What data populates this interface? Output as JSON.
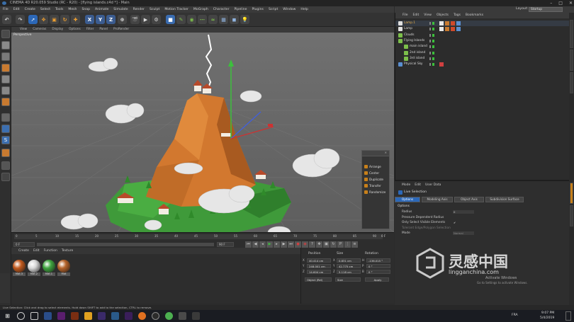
{
  "window": {
    "title": "CINEMA 4D R20.059 Studio (RC - R20) - [flying islands.c4d *] - Main"
  },
  "menubar": {
    "items": [
      "File",
      "Edit",
      "Create",
      "Select",
      "Tools",
      "Mesh",
      "Snap",
      "Animate",
      "Simulate",
      "Render",
      "Sculpt",
      "Motion Tracker",
      "MoGraph",
      "Character",
      "Pipeline",
      "Plugins",
      "Script",
      "Window",
      "Help"
    ]
  },
  "layout": {
    "label": "Layout:",
    "value": "Startup"
  },
  "toolbar": {
    "x": "X",
    "y": "Y",
    "z": "Z"
  },
  "viewport": {
    "menu": [
      "View",
      "Cameras",
      "Display",
      "Options",
      "Filter",
      "Panel",
      "ProRender"
    ],
    "label": "Perspective"
  },
  "popup": {
    "items": [
      "Arrange",
      "Center",
      "Duplicate",
      "Transfer",
      "Randomize"
    ]
  },
  "timeline": {
    "ticks": [
      "0",
      "5",
      "10",
      "15",
      "20",
      "25",
      "30",
      "35",
      "40",
      "45",
      "50",
      "55",
      "60",
      "65",
      "70",
      "75",
      "80",
      "85",
      "90"
    ],
    "frame_start": "0 F",
    "current": "0 F",
    "frame_end": "90 F",
    "max": "90 F",
    "end_label": "0 F"
  },
  "materials": {
    "menu": [
      "Create",
      "Edit",
      "Function",
      "Texture"
    ],
    "items": [
      {
        "label": "Mat.3",
        "color": "#c25a1e"
      },
      {
        "label": "Mat.2",
        "color": "#d8d8d8"
      },
      {
        "label": "Mat.1",
        "color": "#3fa53f"
      },
      {
        "label": "Mat",
        "color": "#b5632a"
      }
    ]
  },
  "coordinates": {
    "headers": [
      "Position",
      "Size",
      "Rotation"
    ],
    "rows": [
      {
        "axis": "X",
        "pos": "40.414 cm",
        "size_axis": "X",
        "size": "0.831 cm",
        "rot_axis": "H",
        "rot": "-136.015 °"
      },
      {
        "axis": "Y",
        "pos": "248.001 cm",
        "size_axis": "Y",
        "size": "42.775 cm",
        "rot_axis": "P",
        "rot": "0 °"
      },
      {
        "axis": "Z",
        "pos": "14.604 cm",
        "size_axis": "Z",
        "size": "5.118 cm",
        "rot_axis": "B",
        "rot": "0 °"
      }
    ],
    "mode": "Object (Rel)",
    "size_mode": "Size",
    "apply": "Apply"
  },
  "objects": {
    "menu": [
      "File",
      "Edit",
      "View",
      "Objects",
      "Tags",
      "Bookmarks"
    ],
    "items": [
      {
        "name": "Lamp.1",
        "indent": 0,
        "color": "#e0e0e0",
        "label_color": "#e8b04a"
      },
      {
        "name": "Lamp",
        "indent": 0,
        "color": "#e0e0e0",
        "label_color": "#d8d8d8"
      },
      {
        "name": "Clouds",
        "indent": 0,
        "color": "#7cbf4a",
        "label_color": "#d8d8d8"
      },
      {
        "name": "Flying Islands",
        "indent": 0,
        "color": "#7cbf4a",
        "label_color": "#d8d8d8"
      },
      {
        "name": "main island",
        "indent": 1,
        "color": "#7cbf4a",
        "label_color": "#d8d8d8"
      },
      {
        "name": "2nd island",
        "indent": 1,
        "color": "#7cbf4a",
        "label_color": "#d8d8d8"
      },
      {
        "name": "3rd island",
        "indent": 1,
        "color": "#7cbf4a",
        "label_color": "#d8d8d8"
      },
      {
        "name": "Physical Sky",
        "indent": 0,
        "color": "#5a8fd0",
        "label_color": "#d8d8d8"
      }
    ]
  },
  "attributes": {
    "menu": [
      "Mode",
      "Edit",
      "User Data"
    ],
    "title": "Live Selection",
    "tabs": [
      "Options",
      "Modeling Axis",
      "Object Axis",
      "Subdivision Surface"
    ],
    "section": "Options",
    "fields": [
      {
        "label": "Radius",
        "value": "0"
      },
      {
        "label": "Pressure Dependent Radius",
        "value": ""
      },
      {
        "label": "Only Select Visible Elements",
        "value": "✔"
      },
      {
        "label": "Tolerant Edge/Polygon Selection",
        "value": ""
      },
      {
        "label": "Mode",
        "value": "Normal"
      }
    ]
  },
  "status": {
    "text": "Live Selection: Click and drag to select elements. Hold down SHIFT to add to the selection, CTRL to remove."
  },
  "watermark": {
    "cn": "灵感中国",
    "url": "lingganchina.com",
    "activate": "Activate Windows",
    "activate_sub": "Go to Settings to activate Windows."
  },
  "taskbar": {
    "time": "9:07 PM",
    "date": "5/4/2019",
    "lang": "FRA"
  }
}
